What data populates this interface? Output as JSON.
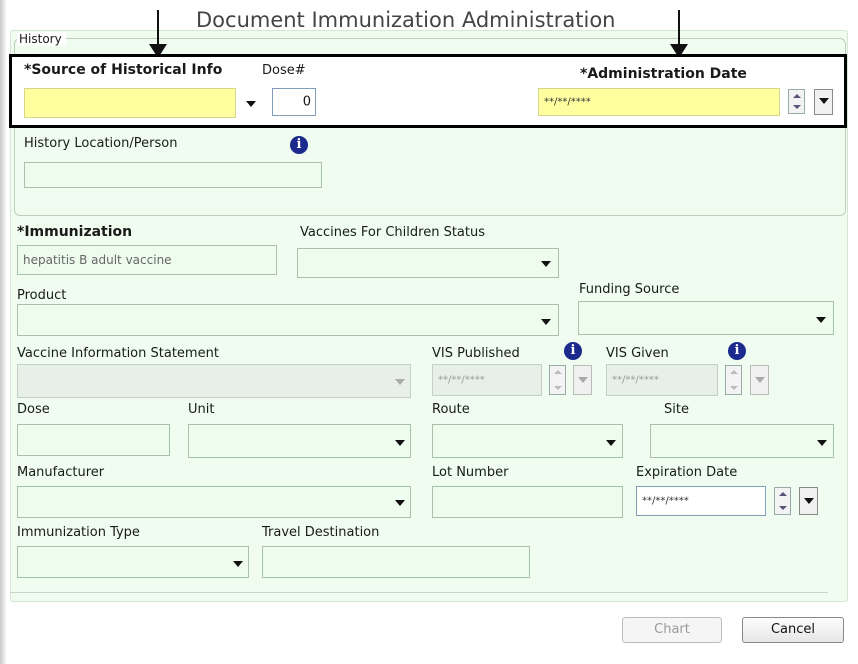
{
  "dialog": {
    "title": "Document Immunization Administration"
  },
  "history": {
    "legend": "History",
    "source_label": "*Source of Historical Info",
    "source_value": "",
    "dose_label": "Dose#",
    "dose_value": "0",
    "admin_date_label": "*Administration Date",
    "admin_date_value": "**/**/****",
    "location_label": "History Location/Person",
    "location_value": ""
  },
  "form": {
    "immunization_label": "*Immunization",
    "immunization_value": "hepatitis B adult vaccine",
    "vfc_label": "Vaccines For Children Status",
    "product_label": "Product",
    "funding_label": "Funding Source",
    "vis_label": "Vaccine Information Statement",
    "vis_published_label": "VIS Published",
    "vis_published_value": "**/**/****",
    "vis_given_label": "VIS Given",
    "vis_given_value": "**/**/****",
    "dose_label": "Dose",
    "unit_label": "Unit",
    "route_label": "Route",
    "site_label": "Site",
    "manufacturer_label": "Manufacturer",
    "lot_label": "Lot Number",
    "expiration_label": "Expiration Date",
    "expiration_value": "**/**/****",
    "imm_type_label": "Immunization Type",
    "travel_label": "Travel Destination"
  },
  "buttons": {
    "chart": "Chart",
    "cancel": "Cancel"
  },
  "icons": [
    "arrow-down-icon",
    "info-icon",
    "chevron-down-icon",
    "spinner-icon"
  ],
  "colors": {
    "panel_bg": "#effcef",
    "highlight_yellow": "#ffffa0",
    "info_icon": "#1b2a8c"
  }
}
